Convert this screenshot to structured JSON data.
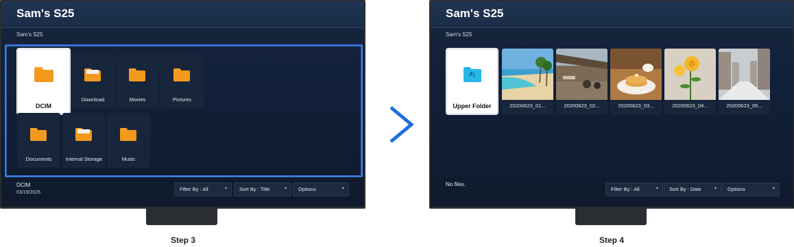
{
  "left": {
    "title": "Sam's S25",
    "breadcrumb": "Sam's S25",
    "folders_row1": [
      "DCIM",
      "Download",
      "Movies",
      "Pictures"
    ],
    "folders_row2": [
      "Documents",
      "Internal Storage",
      "Music"
    ],
    "status": {
      "name": "DCIM",
      "date": "03/19/2025"
    },
    "controls": [
      "Filter By : All",
      "Sort By : Title",
      "Options"
    ],
    "caption": "Step 3"
  },
  "right": {
    "title": "Sam's S25",
    "breadcrumb": "Sam's S25",
    "upper_folder": "Upper Folder",
    "thumbnails": [
      "20200623_01...",
      "20200623_02...",
      "20200623_03...",
      "20200623_04...",
      "20200623_05..."
    ],
    "status": "No files.",
    "controls": [
      "Filter By : All",
      "Sort By : Date",
      "Options"
    ],
    "caption": "Step 4"
  },
  "colors": {
    "accent": "#3f7de0",
    "folder": "#f39a1e",
    "arrow": "#1d6fe0",
    "upper_folder": "#29b6e6"
  },
  "icons": {
    "control_caret": "▴",
    "step_arrow": "chevron-right-icon"
  }
}
